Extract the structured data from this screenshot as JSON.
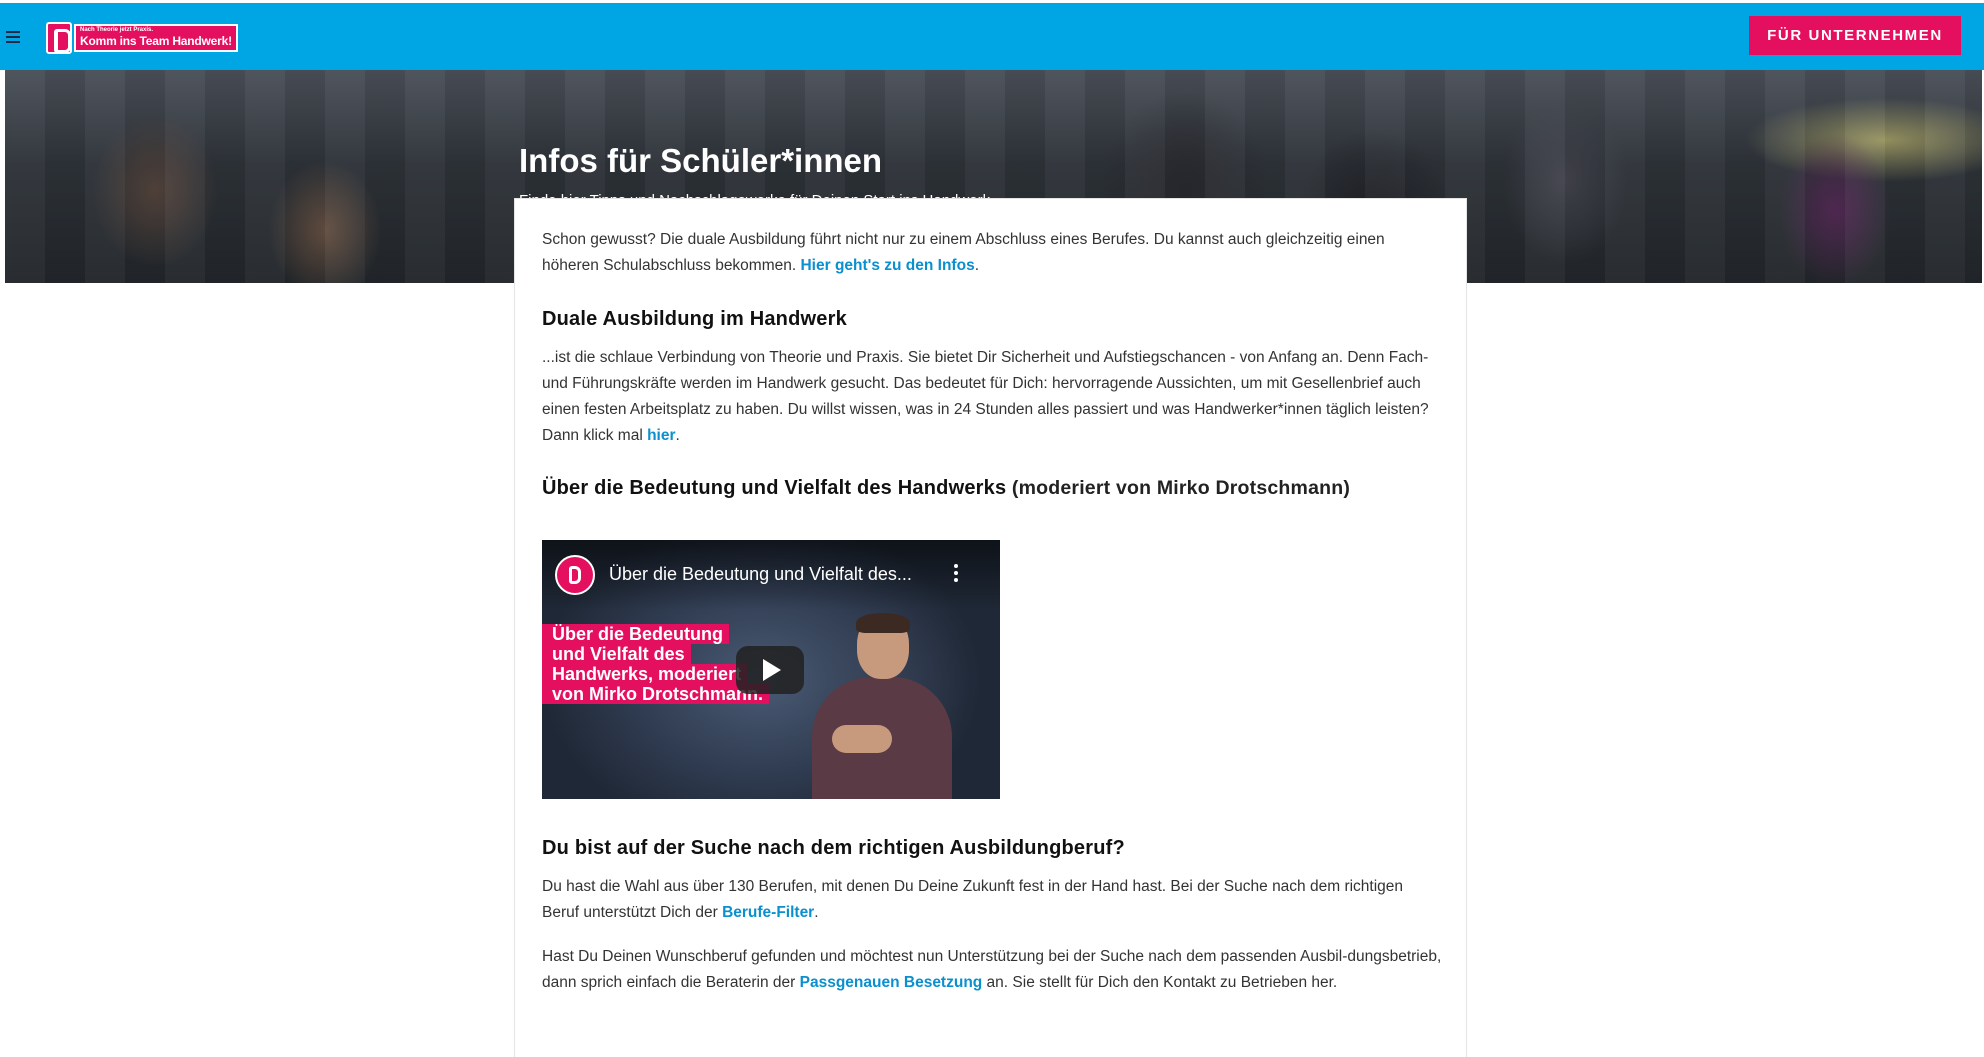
{
  "header": {
    "logo_small": "Nach Theorie jetzt Praxis.",
    "logo_big": "Komm ins Team Handwerk!",
    "cta_label": "FÜR UNTERNEHMEN"
  },
  "hero": {
    "title": "Infos für Schüler*innen",
    "subtitle": "Finde hier Tipps und Nachschlagewerke für Deinen Start ins Handwerk."
  },
  "content": {
    "intro_text": "Schon gewusst? Die duale Ausbildung führt nicht nur zu einem Abschluss eines Berufes. Du kannst auch gleichzeitig einen höheren Schulabschluss bekommen. ",
    "intro_link": "Hier geht's zu den Infos",
    "intro_after": ".",
    "section1_title": "Duale Ausbildung im Handwerk",
    "section1_text": "...ist die schlaue Verbindung von Theorie und Praxis. Sie bietet Dir Sicherheit und Aufstiegschancen - von Anfang an. Denn Fach- und Führungskräfte werden im Handwerk gesucht. Das bedeutet für Dich: hervorragende Aussichten, um mit Gesellenbrief auch einen festen Arbeitsplatz zu haben. Du willst wissen, was in 24 Stunden alles passiert und was Handwerker*innen täglich leisten? Dann klick mal ",
    "section1_link": "hier",
    "section1_after": ".",
    "section2_title": "Über die Bedeutung und Vielfalt des Handwerks",
    "section2_title_suffix": " (moderiert von Mirko Drotschmann)",
    "video": {
      "title": "Über die Bedeutung und Vielfalt des...",
      "caption_lines": [
        "Über die Bedeutung",
        "und Vielfalt des",
        "Handwerks, moderiert",
        "von Mirko Drotschmann."
      ]
    },
    "section3_title": "Du bist auf der Suche nach dem richtigen Ausbildungberuf?",
    "section3_text": "Du hast die Wahl aus über 130 Berufen, mit denen Du Deine Zukunft fest in der Hand hast. Bei der Suche nach dem richtigen Beruf unterstützt Dich der ",
    "section3_link": "Berufe-Filter",
    "section3_after": ".",
    "section4_text": "Hast Du Deinen Wunschberuf gefunden und möchtest nun Unterstützung bei der Suche nach dem passenden Ausbil-dungsbetrieb, dann sprich einfach die Beraterin der ",
    "section4_link": "Passgenauen Besetzung",
    "section4_after": " an. Sie stellt für Dich den Kontakt zu Betrieben her."
  },
  "colors": {
    "topbar": "#00a6e4",
    "accent": "#e50f5f",
    "link": "#0a8fcf"
  },
  "icons": [
    "menu-icon",
    "thumbs-up-logo-icon",
    "play-icon",
    "more-vert-icon"
  ]
}
